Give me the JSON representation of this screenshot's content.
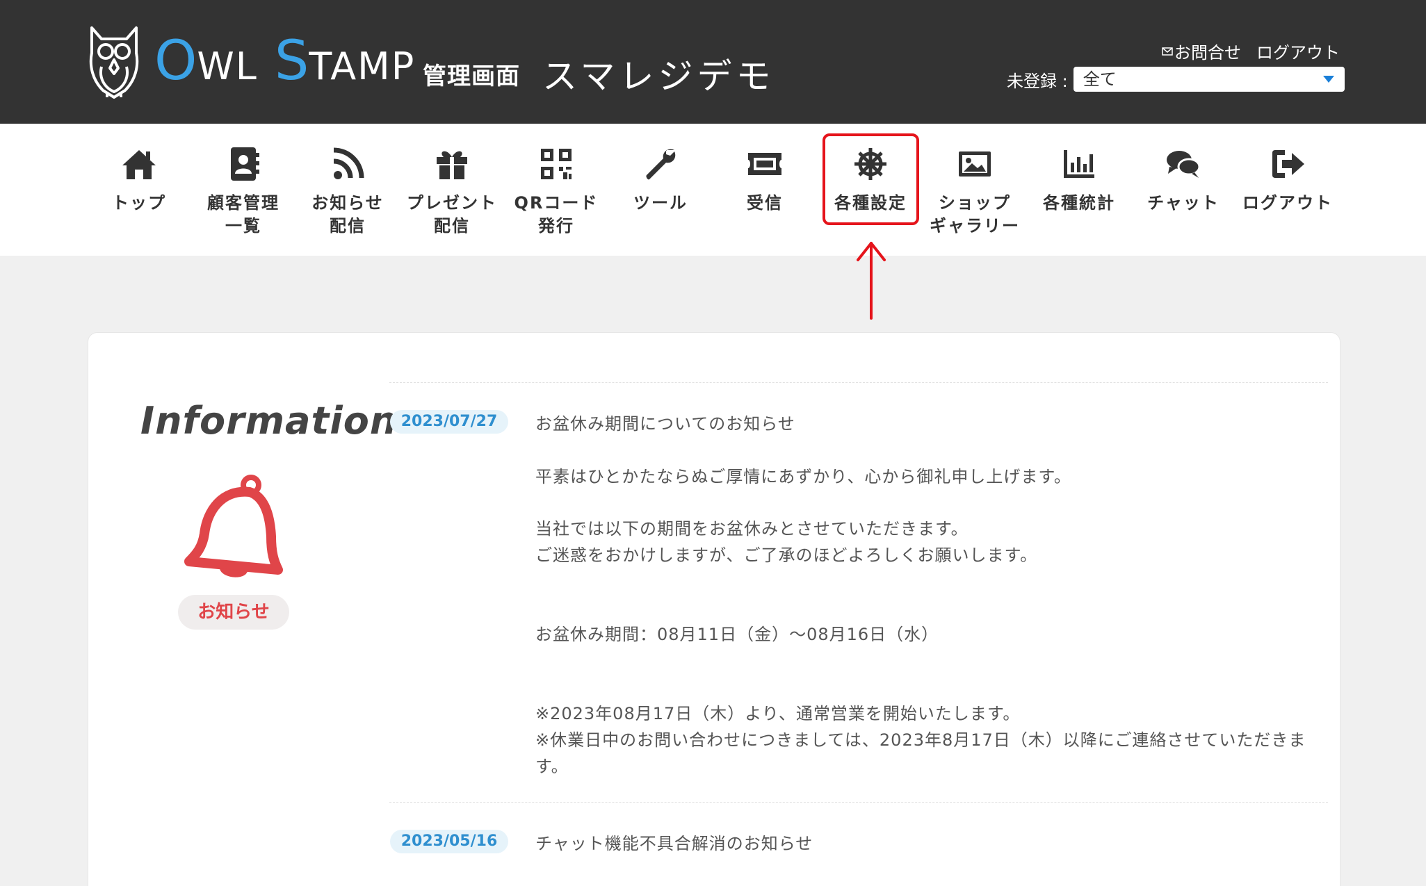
{
  "header": {
    "brand_o": "O",
    "brand_wl": "WL",
    "brand_s": "S",
    "brand_tamp": "TAMP",
    "admin_label": "管理画面",
    "shop_name": "スマレジデモ",
    "contact_label": "お問合せ",
    "logout_label": "ログアウト",
    "filter_label": "未登録 :",
    "filter_value": "全て"
  },
  "nav": {
    "items": [
      {
        "label": "トップ",
        "icon": "home-icon"
      },
      {
        "label": "顧客管理\n一覧",
        "icon": "contacts-icon"
      },
      {
        "label": "お知らせ\n配信",
        "icon": "rss-icon"
      },
      {
        "label": "プレゼント\n配信",
        "icon": "gift-icon"
      },
      {
        "label": "QRコード\n発行",
        "icon": "qr-code-icon"
      },
      {
        "label": "ツール",
        "icon": "wrench-icon"
      },
      {
        "label": "受信",
        "icon": "ticket-icon"
      },
      {
        "label": "各種設定",
        "icon": "ship-wheel-icon"
      },
      {
        "label": "ショップ\nギャラリー",
        "icon": "image-icon"
      },
      {
        "label": "各種統計",
        "icon": "bar-chart-icon"
      },
      {
        "label": "チャット",
        "icon": "chat-icon"
      },
      {
        "label": "ログアウト",
        "icon": "sign-out-icon"
      }
    ]
  },
  "info": {
    "title": "Information",
    "badge": "お知らせ"
  },
  "news": [
    {
      "date": "2023/07/27",
      "title": "お盆休み期間についてのお知らせ",
      "lines": [
        "平素はひとかたならぬご厚情にあずかり、心から御礼申し上げます。",
        "当社では以下の期間をお盆休みとさせていただきます。",
        "ご迷惑をおかけしますが、ご了承のほどよろしくお願いします。",
        "お盆休み期間：08月11日（金）〜08月16日（水）",
        "※2023年08月17日（木）より、通常営業を開始いたします。",
        "※休業日中のお問い合わせにつきましては、2023年8月17日（木）以降にご連絡させていただきま",
        "す。"
      ]
    },
    {
      "date": "2023/05/16",
      "title": "チャット機能不具合解消のお知らせ"
    }
  ],
  "colors": {
    "header_bg": "#333333",
    "brand_blue": "#3ba2e6",
    "highlight_red": "#e5141b",
    "bell_red": "#e04549",
    "date_badge_bg": "#e6f3fa",
    "date_badge_text": "#2f8fcf"
  }
}
